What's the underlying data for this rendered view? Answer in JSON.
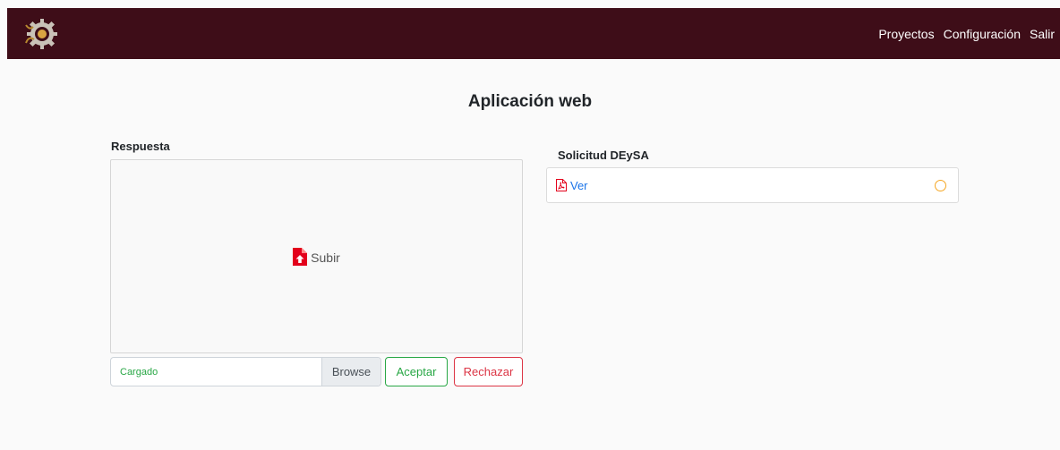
{
  "colors": {
    "nav_bg": "#3e0d18",
    "success": "#28a745",
    "danger": "#dc3545",
    "link": "#1a73e8",
    "pending": "#f5a623",
    "pdf_red": "#e3001b"
  },
  "nav": {
    "logo_icon": "gear-emblem-icon",
    "links": [
      "Proyectos",
      "Configuración",
      "Salir"
    ]
  },
  "page": {
    "title": "Aplicación web"
  },
  "respuesta": {
    "label": "Respuesta",
    "upload_icon": "file-upload-icon",
    "upload_label": "Subir",
    "file_status": "Cargado",
    "browse_label": "Browse",
    "accept_label": "Aceptar",
    "reject_label": "Rechazar"
  },
  "solicitud": {
    "label": "Solicitud DEySA",
    "file_icon": "pdf-file-icon",
    "link_text": "Ver",
    "status_icon": "pending-circle-icon"
  }
}
